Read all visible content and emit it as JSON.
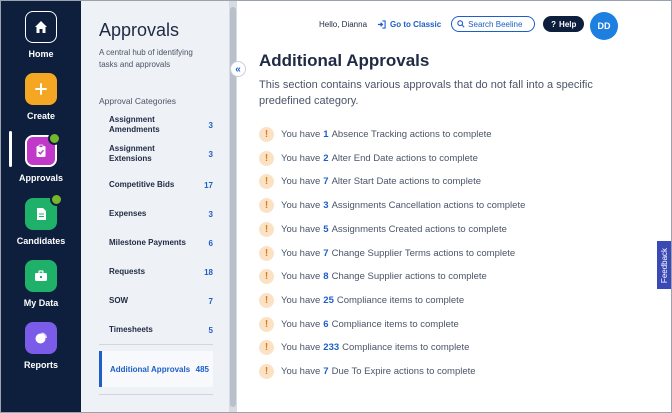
{
  "rail": {
    "items": [
      {
        "label": "Home",
        "icon": "home-icon",
        "color": "#0e1f3d"
      },
      {
        "label": "Create",
        "icon": "plus-icon",
        "color": "#f5a623"
      },
      {
        "label": "Approvals",
        "icon": "clipboard-check-icon",
        "color": "#c039c9"
      },
      {
        "label": "Candidates",
        "icon": "document-icon",
        "color": "#1fb16a"
      },
      {
        "label": "My Data",
        "icon": "briefcase-icon",
        "color": "#1fb16a"
      },
      {
        "label": "Reports",
        "icon": "pie-chart-icon",
        "color": "#7b5ce8"
      }
    ]
  },
  "panel": {
    "title": "Approvals",
    "description": "A central hub of identifying tasks and approvals",
    "categories_heading": "Approval Categories",
    "categories": [
      {
        "label": "Assignment Amendments",
        "count": "3"
      },
      {
        "label": "Assignment Extensions",
        "count": "3"
      },
      {
        "label": "Competitive Bids",
        "count": "17"
      },
      {
        "label": "Expenses",
        "count": "3"
      },
      {
        "label": "Milestone Payments",
        "count": "6"
      },
      {
        "label": "Requests",
        "count": "18"
      },
      {
        "label": "SOW",
        "count": "7"
      },
      {
        "label": "Timesheets",
        "count": "5"
      }
    ],
    "active_category": {
      "label": "Additional Approvals",
      "count": "485"
    }
  },
  "header": {
    "greeting": "Hello, Dianna",
    "go_classic": "Go to Classic",
    "search_placeholder": "Search Beeline",
    "help": "Help",
    "avatar_initials": "DD"
  },
  "main": {
    "title": "Additional Approvals",
    "description": "This section contains various approvals that do not fall into a specific predefined category.",
    "items": [
      {
        "prefix": "You have",
        "count": "1",
        "text": "Absence Tracking actions to complete"
      },
      {
        "prefix": "You have",
        "count": "2",
        "text": "Alter End Date actions to complete"
      },
      {
        "prefix": "You have",
        "count": "7",
        "text": "Alter Start Date actions to complete"
      },
      {
        "prefix": "You have",
        "count": "3",
        "text": "Assignments Cancellation actions to complete"
      },
      {
        "prefix": "You have",
        "count": "5",
        "text": "Assignments Created actions to complete"
      },
      {
        "prefix": "You have",
        "count": "7",
        "text": "Change Supplier Terms actions to complete"
      },
      {
        "prefix": "You have",
        "count": "8",
        "text": "Change Supplier actions to complete"
      },
      {
        "prefix": "You have",
        "count": "25",
        "text": "Compliance items to complete"
      },
      {
        "prefix": "You have",
        "count": "6",
        "text": "Compliance items to complete"
      },
      {
        "prefix": "You have",
        "count": "233",
        "text": "Compliance items to complete"
      },
      {
        "prefix": "You have",
        "count": "7",
        "text": "Due To Expire actions to complete"
      }
    ]
  },
  "feedback": "Feedback"
}
